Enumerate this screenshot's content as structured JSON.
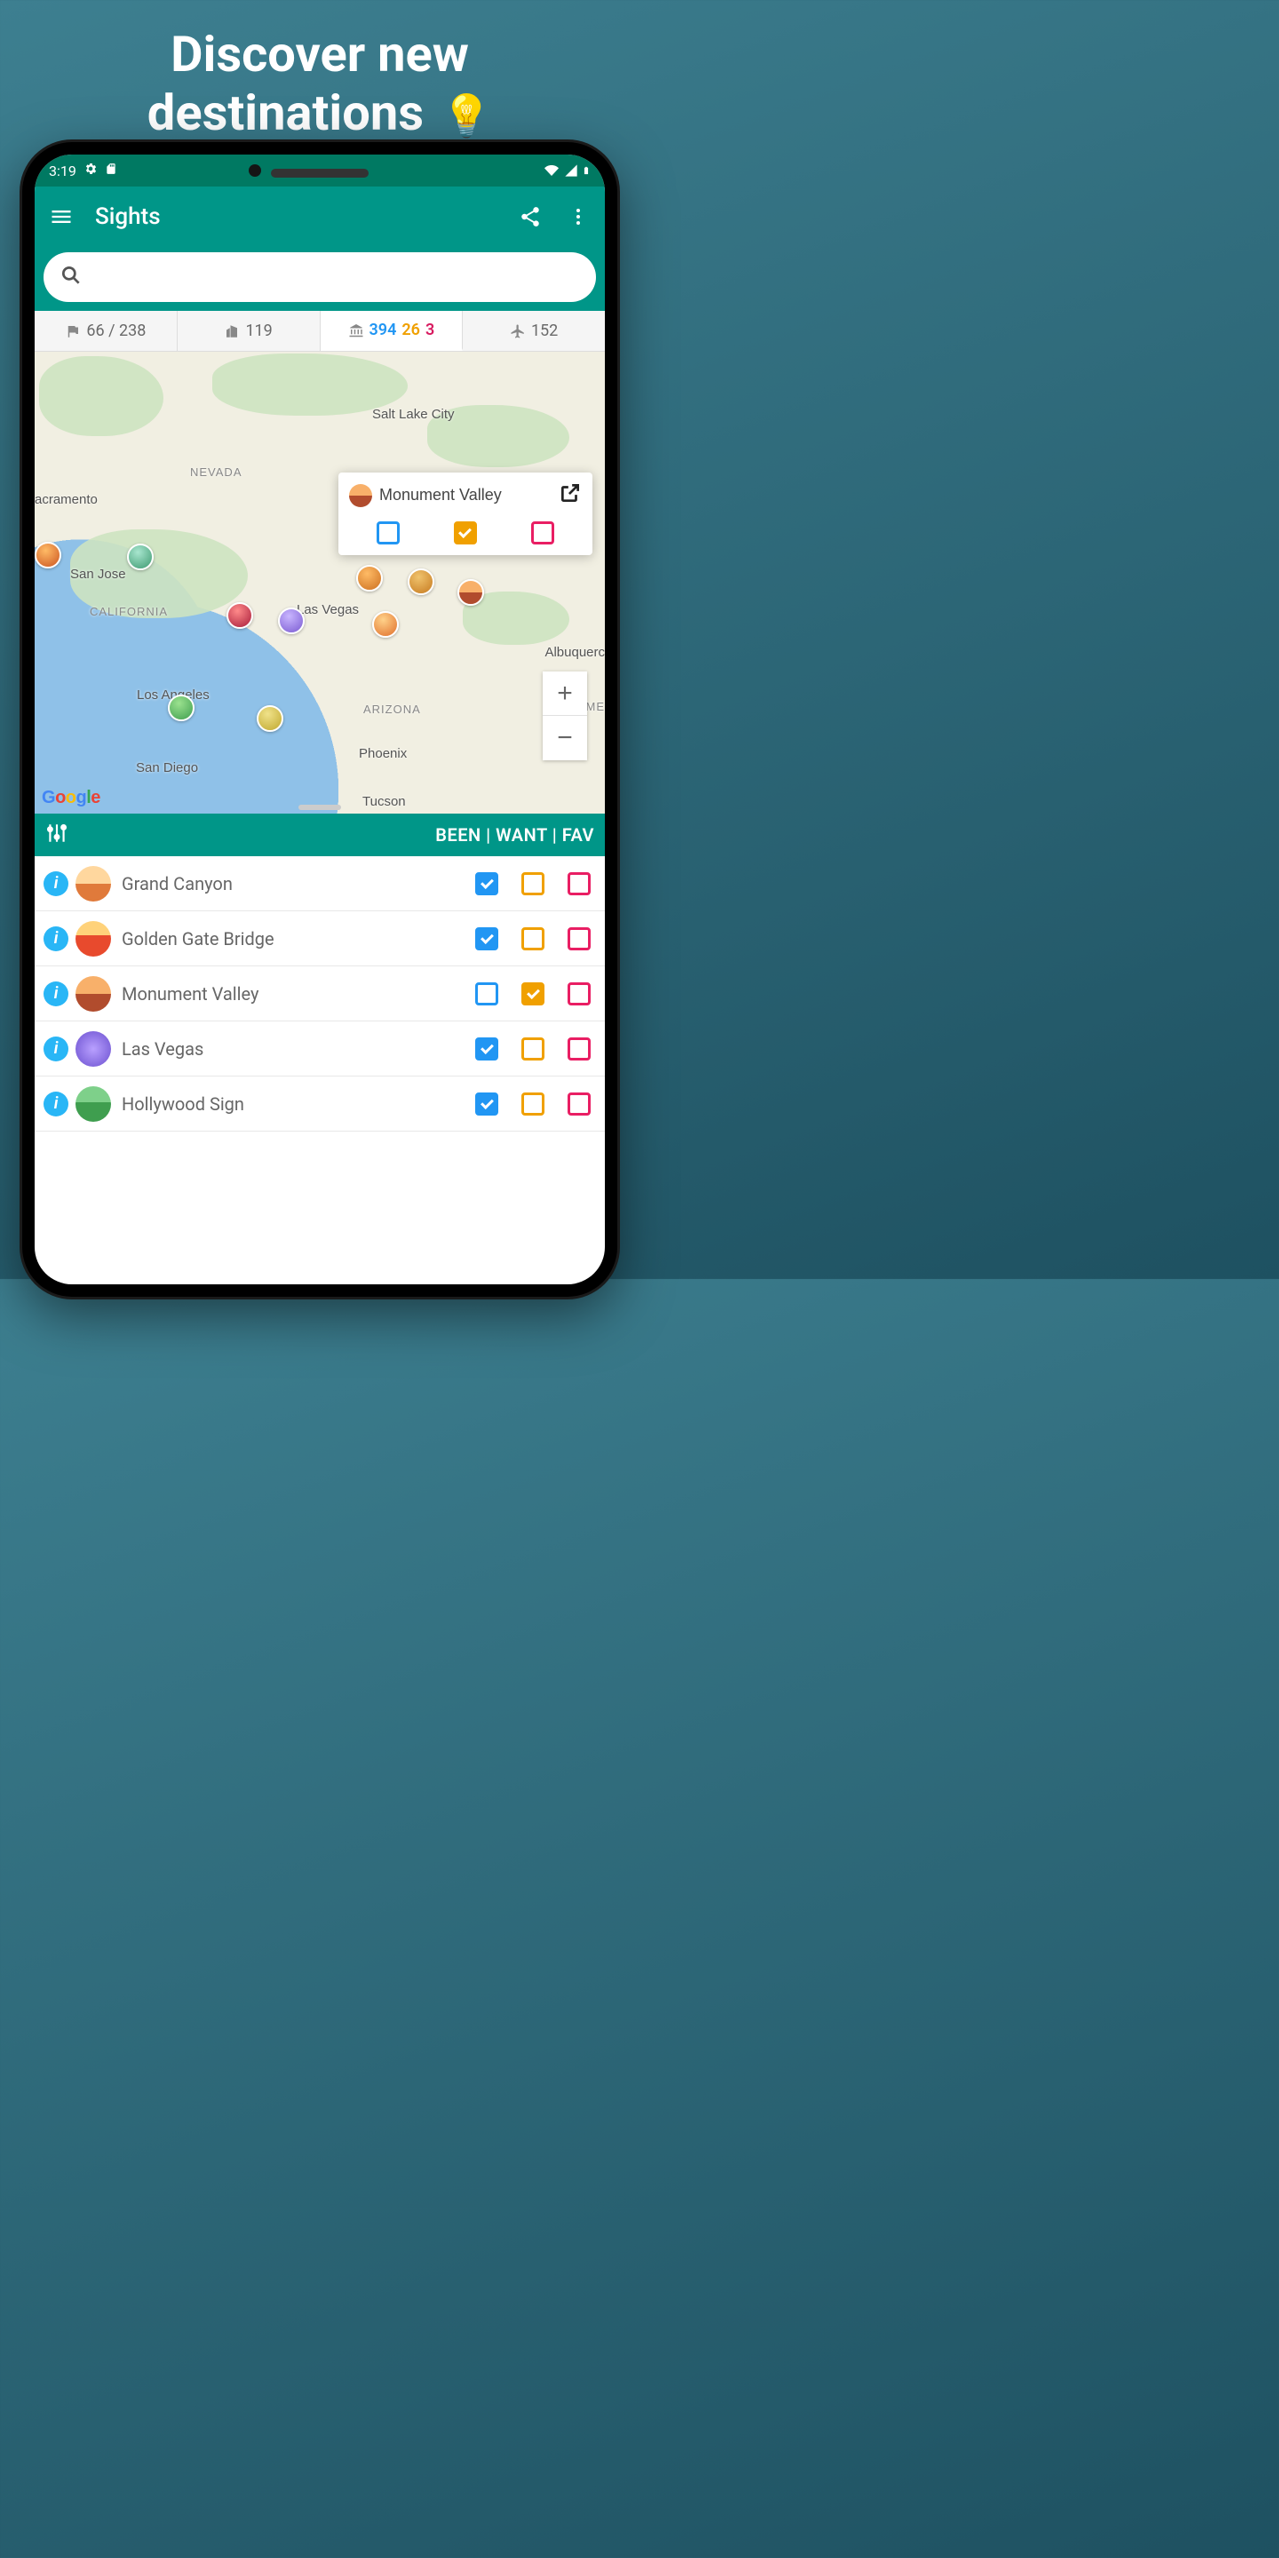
{
  "promo": {
    "line1": "Discover new",
    "line2": "destinations",
    "icon": "💡"
  },
  "status": {
    "time": "3:19"
  },
  "appbar": {
    "title": "Sights"
  },
  "search": {
    "placeholder": ""
  },
  "stats": {
    "flags": "66 / 238",
    "cities": "119",
    "sights_blue": "394",
    "sights_yellow": "26",
    "sights_red": "3",
    "airports": "152"
  },
  "map": {
    "labels": {
      "saltlake": "Salt Lake City",
      "nevada": "NEVADA",
      "sacramento": "acramento",
      "sanjose": "San Jose",
      "california": "CALIFORNIA",
      "lasvegas": "Las Vegas",
      "losangeles": "Los Angeles",
      "arizona": "ARIZONA",
      "sandiego": "San Diego",
      "phoenix": "Phoenix",
      "tucson": "Tucson",
      "albuquerque": "Albuquerc",
      "nm": "N ME"
    },
    "popup": {
      "title": "Monument Valley"
    }
  },
  "filters": {
    "text": "BEEN | WANT | FAV"
  },
  "sights": [
    {
      "name": "Grand Canyon",
      "been": true,
      "want": false,
      "fav": false,
      "thumb_bg": "linear-gradient(#ffd79e 50%,#e07a3b 50%)"
    },
    {
      "name": "Golden Gate Bridge",
      "been": true,
      "want": false,
      "fav": false,
      "thumb_bg": "linear-gradient(#ffd27a 40%,#e84a2d 40%)"
    },
    {
      "name": "Monument Valley",
      "been": false,
      "want": true,
      "fav": false,
      "thumb_bg": "linear-gradient(#f8b06a 50%,#b14c2d 50%)"
    },
    {
      "name": "Las Vegas",
      "been": true,
      "want": false,
      "fav": false,
      "thumb_bg": "radial-gradient(circle,#b9a0ff,#6a4fcf)"
    },
    {
      "name": "Hollywood Sign",
      "been": true,
      "want": false,
      "fav": false,
      "thumb_bg": "linear-gradient(#7ed08a 45%,#3f9e4f 45%)"
    }
  ]
}
